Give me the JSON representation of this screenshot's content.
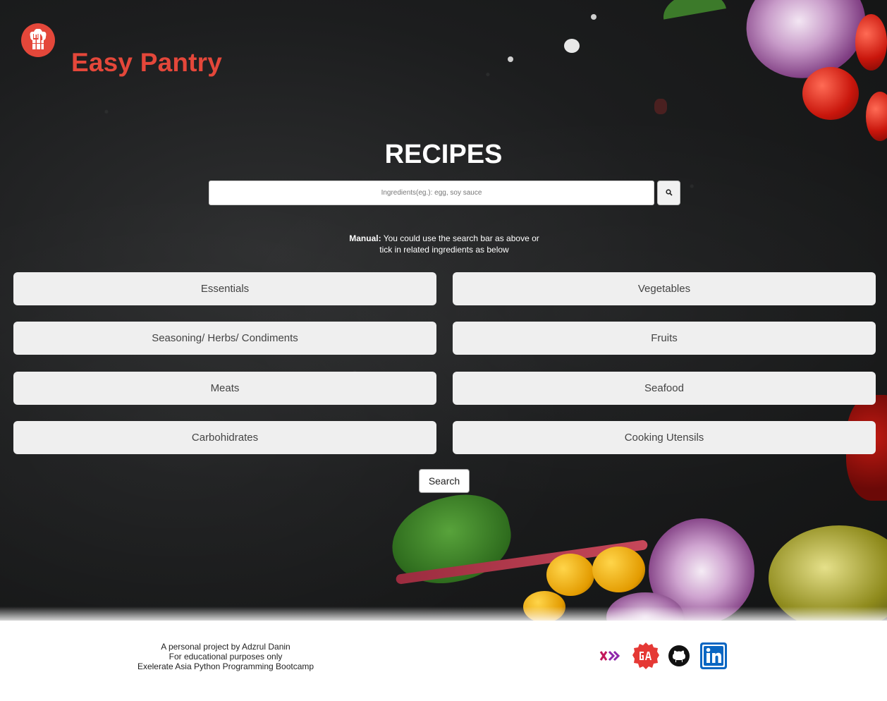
{
  "header": {
    "brand": "Easy Pantry",
    "logo_icon": "chef-hat-utensils-icon"
  },
  "main": {
    "title": "RECIPES",
    "search": {
      "placeholder": "Ingredients(eg.): egg, soy sauce",
      "value": "",
      "icon": "search-icon"
    },
    "manual": {
      "label": "Manual:",
      "line1": "You could use the search bar as above or",
      "line2": "tick in related ingredients as below"
    },
    "categories": [
      "Essentials",
      "Vegetables",
      "Seasoning/ Herbs/ Condiments",
      "Fruits",
      "Meats",
      "Seafood",
      "Carbohidrates",
      "Cooking Utensils"
    ],
    "search_button": "Search"
  },
  "footer": {
    "line1": "A personal project by Adzrul Danin",
    "line2": "For educational purposes only",
    "line3": "Exelerate Asia Python Programming Bootcamp",
    "social_icons": [
      "exelerate-icon",
      "general-assembly-icon",
      "github-icon",
      "linkedin-icon"
    ]
  },
  "colors": {
    "brand": "#e4473a",
    "button_bg": "#efefef",
    "linkedin": "#0a66c2",
    "exelerate": "#c2185b"
  }
}
